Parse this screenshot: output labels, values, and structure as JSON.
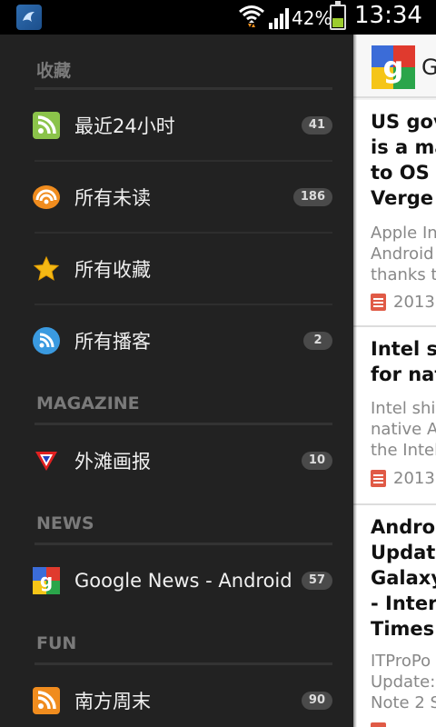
{
  "status_bar": {
    "battery_percent": "42%",
    "battery_level": 0.42,
    "time": "13:34",
    "icons": [
      "app-icon",
      "wifi-icon",
      "signal-icon",
      "battery-icon"
    ]
  },
  "drawer": {
    "sections": {
      "favorites": "收藏",
      "magazine": "MAGAZINE",
      "news": "NEWS",
      "fun": "FUN"
    },
    "items": [
      {
        "label": "最近24小时",
        "count": "41",
        "icon": "rss-icon",
        "color": "#8bc34a"
      },
      {
        "label": "所有未读",
        "count": "186",
        "icon": "unread-feed-icon",
        "color": "#f08c1e"
      },
      {
        "label": "所有收藏",
        "count": "",
        "icon": "star-icon",
        "color": "#f5b914"
      },
      {
        "label": "所有播客",
        "count": "2",
        "icon": "podcast-icon",
        "color": "#3a9ae0"
      },
      {
        "label": "外滩画报",
        "count": "10",
        "icon": "bund-magazine-icon",
        "color": "#e02020"
      },
      {
        "label": "Google News - Android",
        "count": "57",
        "icon": "google-news-icon",
        "color": "#3b6cd8"
      },
      {
        "label": "南方周末",
        "count": "90",
        "icon": "rss-icon",
        "color": "#f08c1e"
      }
    ]
  },
  "content": {
    "header_title": "G",
    "articles": [
      {
        "title": "US gov\nis a ma\nto OS f\nVerge",
        "snippet": "Apple In\nAndroid\nthanks t",
        "date": "2013"
      },
      {
        "title": "Intel sh\nfor nat",
        "snippet": "Intel shi\nnative A\nthe Intel",
        "date": "2013"
      },
      {
        "title": "Androi\nUpdate\nGalaxy\n- Intern\nTimes",
        "snippet": "ITProPo\nUpdate:\nNote 2 S",
        "date": ""
      }
    ]
  }
}
